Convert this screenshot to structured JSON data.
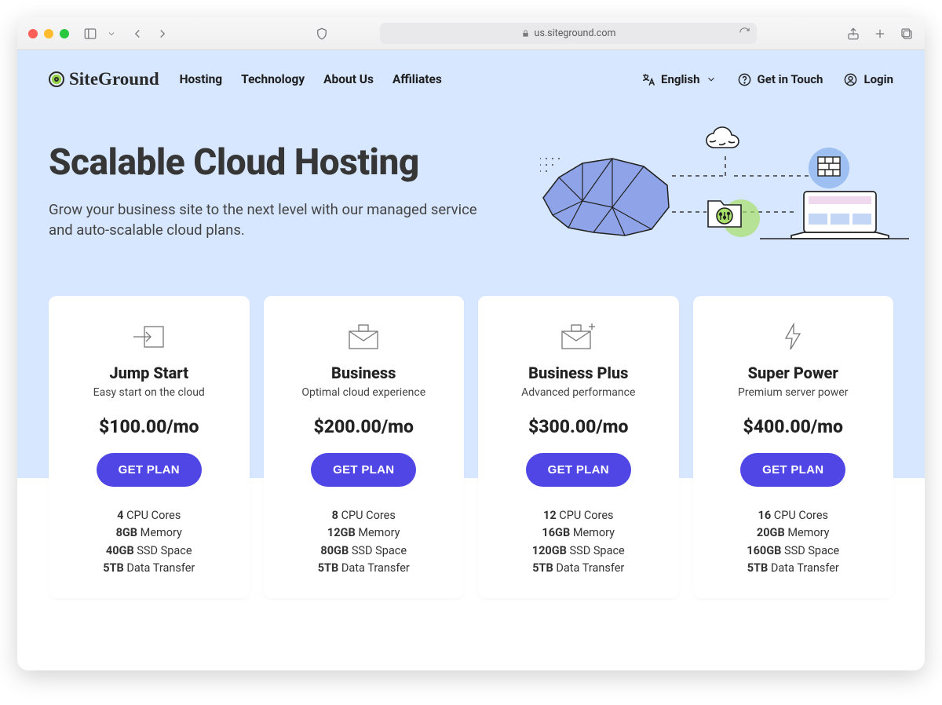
{
  "browser": {
    "url_display": "us.siteground.com"
  },
  "header": {
    "brand": "SiteGround",
    "nav": [
      "Hosting",
      "Technology",
      "About Us",
      "Affiliates"
    ],
    "language_label": "English",
    "contact_label": "Get in Touch",
    "login_label": "Login"
  },
  "hero": {
    "title": "Scalable Cloud Hosting",
    "subtitle": "Grow your business site to the next level with our managed service and auto-scalable cloud plans."
  },
  "cta_label": "GET PLAN",
  "plans": [
    {
      "name": "Jump Start",
      "tagline": "Easy start on the cloud",
      "price": "$100.00/mo",
      "specs": [
        {
          "value": "4",
          "label": "CPU Cores"
        },
        {
          "value": "8GB",
          "label": "Memory"
        },
        {
          "value": "40GB",
          "label": "SSD Space"
        },
        {
          "value": "5TB",
          "label": "Data Transfer"
        }
      ]
    },
    {
      "name": "Business",
      "tagline": "Optimal cloud experience",
      "price": "$200.00/mo",
      "specs": [
        {
          "value": "8",
          "label": "CPU Cores"
        },
        {
          "value": "12GB",
          "label": "Memory"
        },
        {
          "value": "80GB",
          "label": "SSD Space"
        },
        {
          "value": "5TB",
          "label": "Data Transfer"
        }
      ]
    },
    {
      "name": "Business Plus",
      "tagline": "Advanced performance",
      "price": "$300.00/mo",
      "specs": [
        {
          "value": "12",
          "label": "CPU Cores"
        },
        {
          "value": "16GB",
          "label": "Memory"
        },
        {
          "value": "120GB",
          "label": "SSD Space"
        },
        {
          "value": "5TB",
          "label": "Data Transfer"
        }
      ]
    },
    {
      "name": "Super Power",
      "tagline": "Premium server power",
      "price": "$400.00/mo",
      "specs": [
        {
          "value": "16",
          "label": "CPU Cores"
        },
        {
          "value": "20GB",
          "label": "Memory"
        },
        {
          "value": "160GB",
          "label": "SSD Space"
        },
        {
          "value": "5TB",
          "label": "Data Transfer"
        }
      ]
    }
  ]
}
